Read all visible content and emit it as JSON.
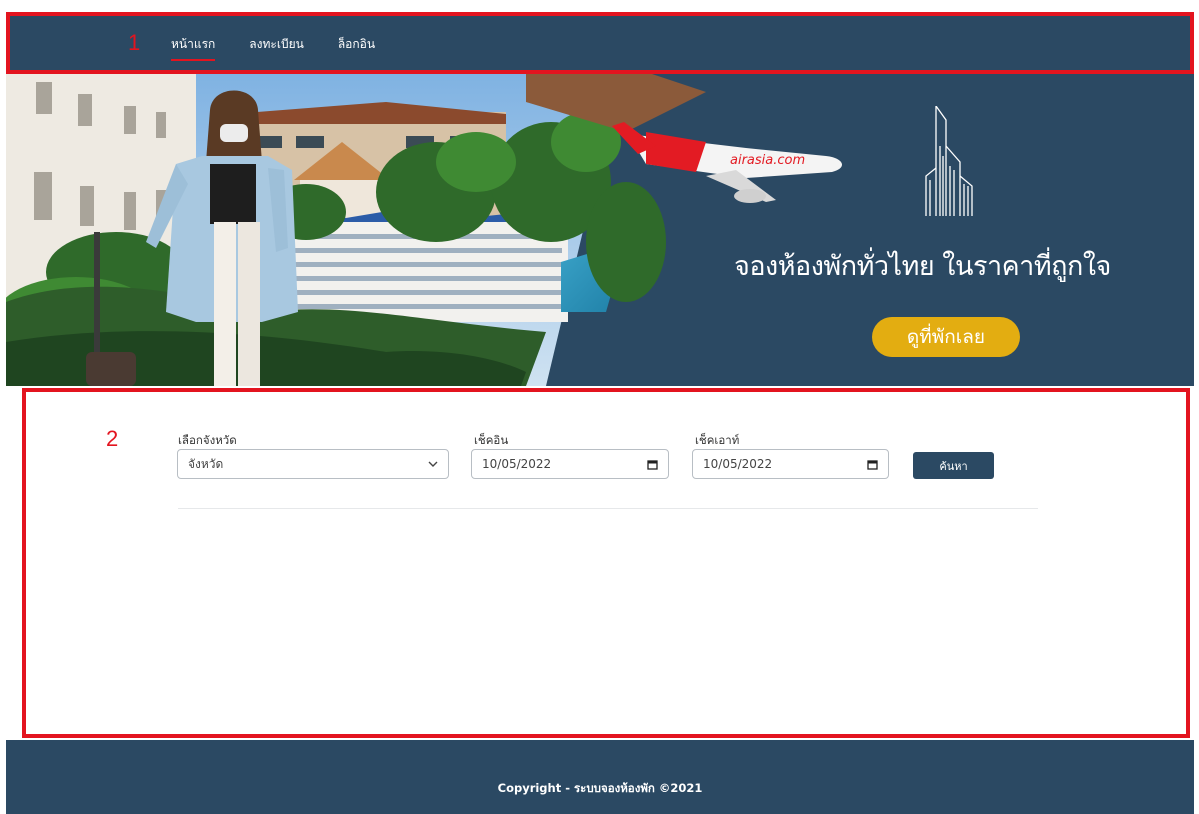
{
  "annotations": {
    "box1_number": "1",
    "box2_number": "2"
  },
  "nav": {
    "items": [
      {
        "label": "หน้าแรก",
        "active": true
      },
      {
        "label": "ลงทะเบียน",
        "active": false
      },
      {
        "label": "ล็อกอิน",
        "active": false
      }
    ]
  },
  "hero": {
    "headline": "จองห้องพักทั่วไทย ในราคาที่ถูกใจ",
    "cta_label": "ดูที่พักเลย",
    "plane_livery": "airasia.com",
    "accent_color": "#e3ad11",
    "background_color": "#2b4963"
  },
  "search": {
    "province_label": "เลือกจังหวัด",
    "province_value": "จังหวัด",
    "checkin_label": "เช็คอิน",
    "checkin_value": "10/05/2022",
    "checkout_label": "เช็คเอาท์",
    "checkout_value": "10/05/2022",
    "search_button": "ค้นหา"
  },
  "footer": {
    "text": "Copyright - ระบบจองห้องพัก ©2021"
  },
  "colors": {
    "annotation": "#e3141f",
    "brand_navy": "#2b4963"
  }
}
